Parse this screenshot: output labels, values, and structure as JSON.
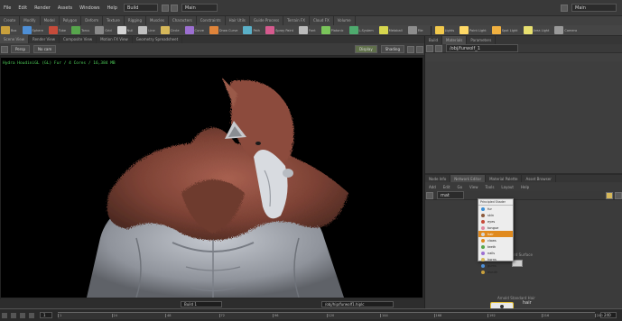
{
  "menubar": {
    "items": [
      "File",
      "Edit",
      "Render",
      "Assets",
      "Windows",
      "Help"
    ],
    "desktop": "Build",
    "scene_field": "Main",
    "right_field": "Main"
  },
  "shelf": {
    "tabs": [
      "Create",
      "Modify",
      "Model",
      "Polygon",
      "Deform",
      "Texture",
      "Rigging",
      "Muscles",
      "Characters",
      "Constraints",
      "Hair Utils",
      "Guide Process",
      "Terrain FX",
      "Cloud FX",
      "Volume"
    ],
    "tools": [
      {
        "label": "Box",
        "color": "#c9a03c"
      },
      {
        "label": "Sphere",
        "color": "#4e8fd6"
      },
      {
        "label": "Tube",
        "color": "#c64b3a"
      },
      {
        "label": "Torus",
        "color": "#57a64c"
      },
      {
        "label": "Grid",
        "color": "#8a8a8a"
      },
      {
        "label": "Null",
        "color": "#d4d4d4"
      },
      {
        "label": "Line",
        "color": "#c0c0c0"
      },
      {
        "label": "Circle",
        "color": "#d6b85a"
      },
      {
        "label": "Curve",
        "color": "#9c6fd1"
      },
      {
        "label": "Draw Curve",
        "color": "#e0843a"
      },
      {
        "label": "Path",
        "color": "#5ab0c8"
      },
      {
        "label": "Spray Paint",
        "color": "#d65a8e"
      },
      {
        "label": "Font",
        "color": "#bbbbbb"
      },
      {
        "label": "Platonic",
        "color": "#7ac45a"
      },
      {
        "label": "L-System",
        "color": "#4eaa6e"
      },
      {
        "label": "Metaball",
        "color": "#d6d64e"
      },
      {
        "label": "File",
        "color": "#8d8d8d"
      }
    ],
    "tools2": [
      {
        "label": "Lights",
        "color": "#f2c94c"
      },
      {
        "label": "Point Light",
        "color": "#ffd966"
      },
      {
        "label": "Spot Light",
        "color": "#f0b040"
      },
      {
        "label": "Area Light",
        "color": "#e8e070"
      },
      {
        "label": "Camera",
        "color": "#9a9a9a"
      }
    ]
  },
  "viewport": {
    "tabs": [
      "Scene View",
      "Render View",
      "Composite View",
      "Motion FX View",
      "Geometry Spreadsheet"
    ],
    "toolbar": [
      "Persp",
      "No cam",
      "Display",
      "Shading"
    ],
    "status_left": "Build 1",
    "status_right": "/obj/hip/furwolf1.hiplc",
    "info_text": "Hydra HoudiniGL  (GL) Fur / 4 Cores / 16,384 MB"
  },
  "right": {
    "tabs": [
      "Build",
      "Materials",
      "Parameters"
    ],
    "path": "/obj/furwolf_1"
  },
  "network": {
    "tabs": [
      "Node Info",
      "Network Editor",
      "Material Palette",
      "Asset Browser"
    ],
    "toolbar": [
      "Add",
      "Edit",
      "Go",
      "View",
      "Tools",
      "Layout",
      "Help"
    ],
    "path": "mat",
    "menu": {
      "header": "Principled Shader",
      "items": [
        {
          "label": "fur",
          "color": "#3a8fd6"
        },
        {
          "label": "skin",
          "color": "#8c5a3c"
        },
        {
          "label": "eyes",
          "color": "#c64b3a"
        },
        {
          "label": "tongue",
          "color": "#e08aa0"
        },
        {
          "label": "hair",
          "color": "#d6d6d6",
          "selected": true
        },
        {
          "label": "claws",
          "color": "#e08a1e"
        },
        {
          "label": "teeth",
          "color": "#57a64c"
        },
        {
          "label": "nails",
          "color": "#9c6fd1"
        },
        {
          "label": "horns",
          "color": "#d6b85a"
        },
        {
          "label": "gums",
          "color": "#4e8fd6"
        },
        {
          "label": "mouth",
          "color": "#c9a03c"
        }
      ]
    },
    "nodes": [
      {
        "type": "Arnold Standard Surface",
        "name": "GRAY"
      },
      {
        "type": "Arnold Standard Hair",
        "name": "hair"
      }
    ]
  },
  "timeline": {
    "frames": [
      "1",
      "24",
      "48",
      "72",
      "96",
      "120",
      "144",
      "168",
      "192",
      "216",
      "240"
    ],
    "current": "1",
    "end": "240"
  },
  "colors": {
    "menu_selected": "#e08a1e",
    "viewport_info": "#4fd05a",
    "fur": "#8a4a3a",
    "skin": "#9a9ea6"
  }
}
